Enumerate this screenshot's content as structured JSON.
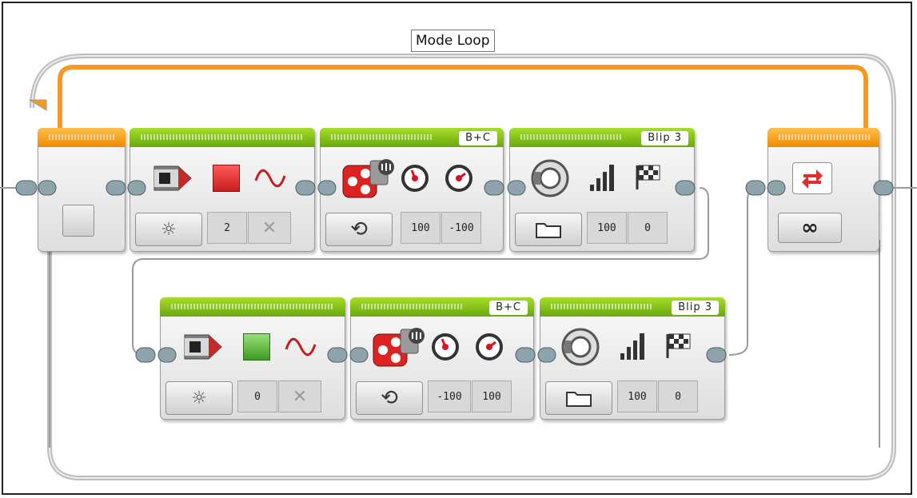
{
  "loop": {
    "label": "Mode Loop",
    "colors": {
      "wire": "#f39a22",
      "frame": "#bdbdbd"
    },
    "start_block": {
      "icon": "loop-start"
    },
    "end_block": {
      "mode_icon": "loop-repeat-icon",
      "count_label": "∞"
    }
  },
  "row1": {
    "light": {
      "mode_icon": "light-bulb-icon",
      "color_icon": "red-square",
      "pulse_icon": "sine-wave-icon",
      "values": [
        "2",
        "✕"
      ],
      "swatch": "#e33636"
    },
    "move": {
      "ports": "B+C",
      "mode_icon": "rotate-icon",
      "values": [
        "100",
        "-100"
      ]
    },
    "sound": {
      "file": "Blip 3",
      "mode_icon": "folder-icon",
      "values": [
        "100",
        "0"
      ]
    }
  },
  "row2": {
    "light": {
      "mode_icon": "light-bulb-icon",
      "color_icon": "green-square",
      "pulse_icon": "sine-wave-icon",
      "values": [
        "0",
        "✕"
      ],
      "swatch": "#5ab534"
    },
    "move": {
      "ports": "B+C",
      "mode_icon": "rotate-icon",
      "values": [
        "-100",
        "100"
      ]
    },
    "sound": {
      "file": "Blip 3",
      "mode_icon": "folder-icon",
      "values": [
        "100",
        "0"
      ]
    }
  }
}
